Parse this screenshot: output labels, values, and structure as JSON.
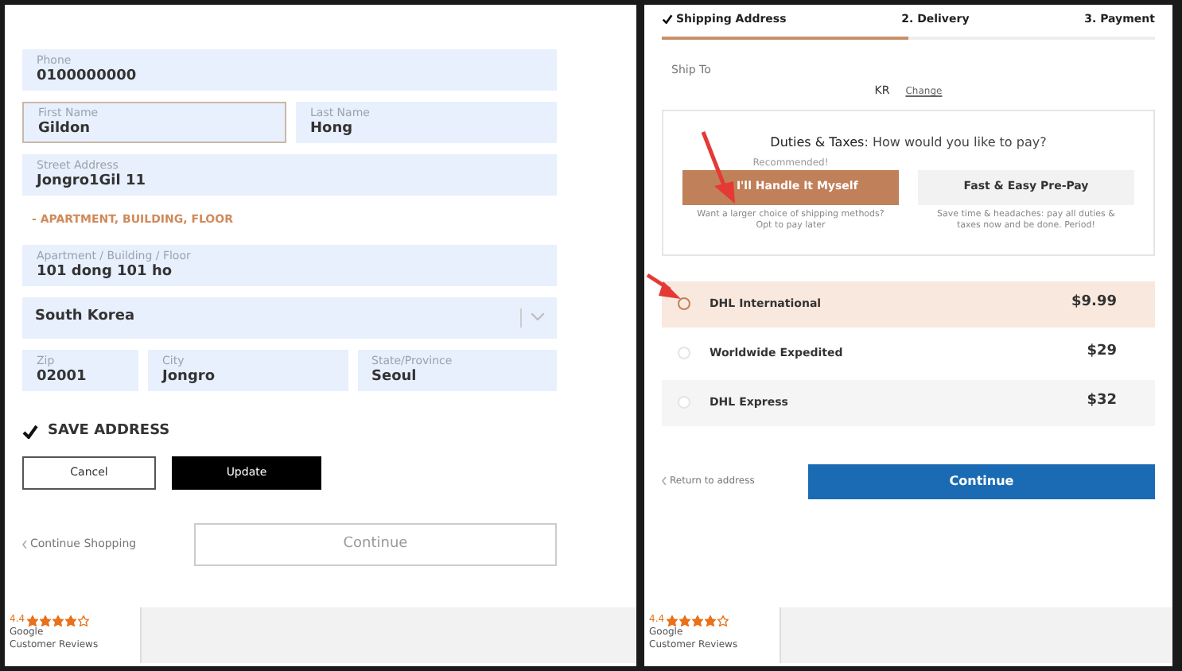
{
  "address_form": {
    "fields_top": [
      {
        "label": "Phone",
        "value": "0100000000",
        "focused": false
      }
    ],
    "name_fields": [
      {
        "label": "First Name",
        "value": "Gildon",
        "focused": true
      },
      {
        "label": "Last Name",
        "value": "Hong",
        "focused": false
      }
    ],
    "street": {
      "label": "Street Address",
      "value": "Jongro1Gil 11",
      "focused": false
    },
    "apartment_toggle": "- APARTMENT, BUILDING, FLOOR",
    "apartment": {
      "label": "Apartment / Building / Floor",
      "value": "101 dong 101 ho",
      "focused": false
    },
    "country": {
      "value": "South Korea"
    },
    "locality_fields": [
      {
        "label": "Zip",
        "value": "02001",
        "focused": false
      },
      {
        "label": "City",
        "value": "Jongro",
        "focused": false
      },
      {
        "label": "State/Province",
        "value": "Seoul",
        "focused": false
      }
    ],
    "save_address": {
      "label": "SAVE ADDRESS",
      "checked": true
    },
    "cancel": "Cancel",
    "update": "Update",
    "back_link": "Continue Shopping",
    "continue": "Continue"
  },
  "delivery": {
    "steps": [
      {
        "label": "Shipping Address",
        "done": true
      },
      {
        "label": "2. Delivery",
        "done": false
      },
      {
        "label": "3. Payment",
        "done": false
      }
    ],
    "progress": {
      "level": 0.5
    },
    "ship_to": {
      "label": "Ship To",
      "country": "KR",
      "change": "Change"
    },
    "duties": {
      "title": "Duties & Taxes",
      "question": ": How would you like to pay?",
      "options": [
        {
          "badge": "Recommended!",
          "label": "I'll Handle It Myself",
          "description": "Want a larger choice of shipping methods? Opt to pay later",
          "selected": true
        },
        {
          "label": "Fast & Easy Pre-Pay",
          "description": "Save time & headaches: pay all duties & taxes now and be done. Period!",
          "selected": false
        }
      ]
    },
    "methods": [
      {
        "name": "DHL International",
        "price": "$9.99",
        "selected": true
      },
      {
        "name": "Worldwide Expedited",
        "price": "$29",
        "selected": false
      },
      {
        "name": "DHL Express",
        "price": "$32",
        "selected": false
      }
    ],
    "back_link": "Return to address",
    "continue": "Continue"
  },
  "reviews": [
    {
      "rating": "4.4",
      "stars": 4,
      "brand": "Google",
      "caption": "Customer Reviews"
    },
    {
      "rating": "4.4",
      "stars": 4,
      "brand": "Google",
      "caption": "Customer Reviews"
    }
  ]
}
